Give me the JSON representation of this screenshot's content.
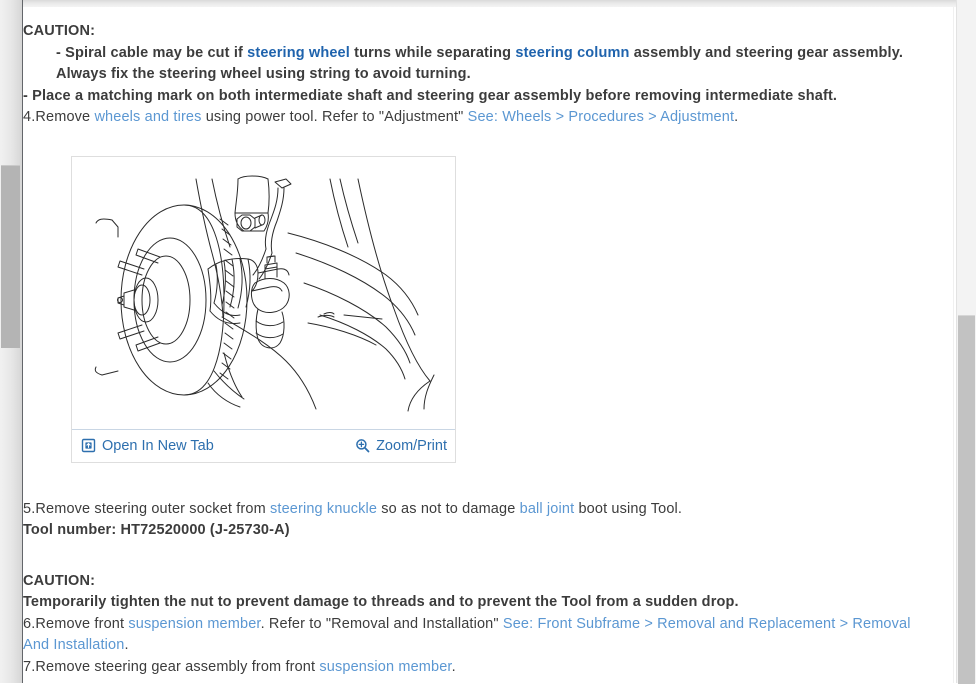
{
  "document": {
    "caution_label_top": "CAUTION:",
    "bullets": [
      {
        "prefix": "- Spiral cable may be cut if ",
        "link1": "steering wheel",
        "mid": " turns while separating ",
        "link2": "steering column",
        "suffix": " assembly and steering gear assembly. Always fix the steering wheel using string to avoid turning."
      },
      {
        "text": "- Place a matching mark on both intermediate shaft and steering gear assembly before removing intermediate shaft."
      }
    ],
    "step4": {
      "number": "4.",
      "text_a": "Remove ",
      "link": "wheels and tires",
      "text_b": " using power tool. Refer to \"Adjustment\" ",
      "reference": "See: Wheels > Procedures > Adjustment",
      "period": "."
    },
    "figure": {
      "alt": "Front suspension brake rotor, steering knuckle and tie rod end line drawing",
      "open_in_new_tab": "Open In New Tab",
      "open_icon": "open-in-new-tab-icon",
      "zoom_print": "Zoom/Print",
      "zoom_icon": "magnifier-plus-icon"
    },
    "step5": {
      "number": "5.",
      "text_a": "Remove steering outer socket from ",
      "link1": "steering knuckle",
      "text_b": " so as not to damage ",
      "link2": "ball joint",
      "text_c": " boot using Tool."
    },
    "tool_number": "Tool number: HT72520000 (J-25730-A)",
    "caution_label_bottom": "CAUTION:",
    "caution_text_bottom": "Temporarily tighten the nut to prevent damage to threads and to prevent the Tool from a sudden drop.",
    "step6": {
      "number": "6.",
      "text_a": "Remove front ",
      "link": "suspension member",
      "text_b": ". Refer to \"Removal and Installation\" ",
      "reference": "See: Front Subframe > Removal and Replacement > Removal And Installation",
      "period": "."
    },
    "step7": {
      "number": "7.",
      "text_a": "Remove steering gear assembly from front ",
      "link": "suspension member",
      "period": "."
    }
  },
  "colors": {
    "link": "#5b97d2",
    "link_strong": "#1f63ad",
    "body_text": "#3c3c3c",
    "bold_text": "#313131",
    "toolbar_link": "#2d6fae",
    "figure_border": "#dedede",
    "scrollbar_thumb": "#b4b4b4"
  },
  "scrollbars": {
    "left_name": "page-scrollbar-left",
    "right_name": "page-scrollbar-right"
  }
}
